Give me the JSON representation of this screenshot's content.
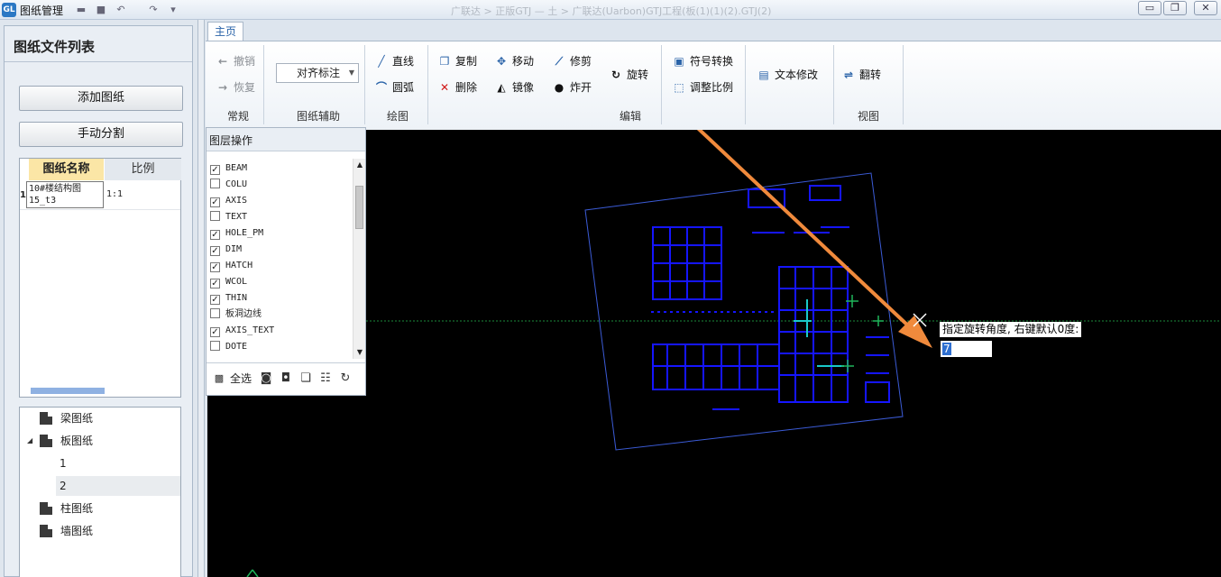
{
  "window": {
    "app_icon": "gl-logo-icon",
    "title": "图纸管理",
    "doc_path": "广联达 > 正版GTJ — 土 > 广联达(Uarbon)GTJ工程(板(1)(1)(2).GTJ(2)"
  },
  "left_panel": {
    "title": "图纸文件列表",
    "add_button": "添加图纸",
    "split_button": "手动分割",
    "table": {
      "headers": [
        "图纸名称",
        "比例"
      ],
      "rows": [
        {
          "index": "1",
          "name": "10#楼结构图15_t3",
          "scale": "1:1"
        }
      ]
    },
    "tree": [
      {
        "label": "梁图纸",
        "expanded": false
      },
      {
        "label": "板图纸",
        "expanded": true
      },
      {
        "label": "1",
        "child": true
      },
      {
        "label": "2",
        "child": true,
        "selected": true
      },
      {
        "label": "柱图纸",
        "expanded": false
      },
      {
        "label": "墙图纸",
        "expanded": false
      }
    ]
  },
  "ribbon": {
    "tab": "主页",
    "groups": {
      "general": {
        "label": "常规",
        "undo": "撤销",
        "redo": "恢复"
      },
      "assist": {
        "label": "图纸辅助",
        "combo_value": "对齐标注"
      },
      "draw": {
        "label": "绘图",
        "line": "直线",
        "arc": "圆弧"
      },
      "edit": {
        "label": "编辑",
        "copy": "复制",
        "move": "移动",
        "trim": "修剪",
        "rotate": "旋转",
        "delete": "删除",
        "mirror": "镜像",
        "explode": "炸开",
        "symbol": "符号转换",
        "scale": "调整比例"
      },
      "text": {
        "modify": "文本修改"
      },
      "view": {
        "label": "视图",
        "flip": "翻转"
      }
    }
  },
  "layer_panel": {
    "title": "图层操作",
    "layers": [
      {
        "name": "BEAM",
        "checked": true
      },
      {
        "name": "COLU",
        "checked": false
      },
      {
        "name": "AXIS",
        "checked": true
      },
      {
        "name": "TEXT",
        "checked": false
      },
      {
        "name": "HOLE_PM",
        "checked": true
      },
      {
        "name": "DIM",
        "checked": true
      },
      {
        "name": "HATCH",
        "checked": true
      },
      {
        "name": "WCOL",
        "checked": true
      },
      {
        "name": "THIN",
        "checked": true
      },
      {
        "name": "板洞边线",
        "checked": false
      },
      {
        "name": "AXIS_TEXT",
        "checked": true
      },
      {
        "name": "DOTE",
        "checked": false
      }
    ],
    "select_all": "全选"
  },
  "canvas": {
    "prompt": "指定旋转角度, 右键默认0度:",
    "input_value": "7"
  },
  "colors": {
    "drawing": "#1515ff",
    "accent": "#f08a3c",
    "cursor": "#ffffff"
  }
}
